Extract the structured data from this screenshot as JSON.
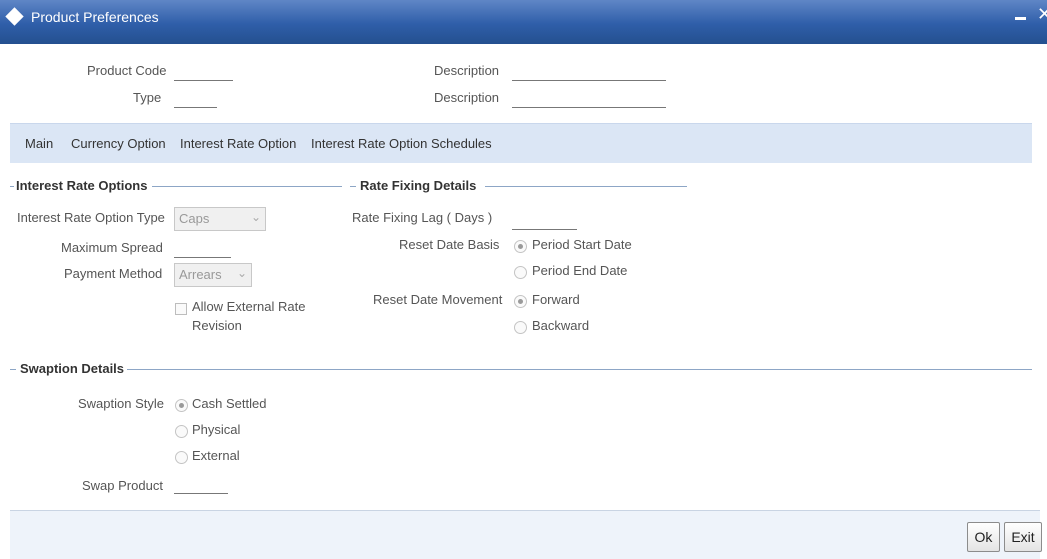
{
  "window": {
    "title": "Product Preferences",
    "minimize": "–",
    "close": "✕"
  },
  "header": {
    "product_code_label": "Product Code",
    "type_label": "Type",
    "description_label_1": "Description",
    "description_label_2": "Description"
  },
  "tabs": [
    {
      "label": "Main"
    },
    {
      "label": "Currency Option"
    },
    {
      "label": "Interest Rate Option"
    },
    {
      "label": "Interest Rate Option Schedules"
    }
  ],
  "interest_rate_options": {
    "section_title": "Interest Rate Options",
    "option_type_label": "Interest Rate Option Type",
    "option_type_value": "Caps",
    "max_spread_label": "Maximum Spread",
    "payment_method_label": "Payment Method",
    "payment_method_value": "Arrears",
    "allow_external_line1": "Allow External Rate",
    "allow_external_line2": "Revision"
  },
  "rate_fixing": {
    "section_title": "Rate Fixing Details",
    "lag_label": "Rate Fixing Lag ( Days )",
    "reset_basis_label": "Reset Date Basis",
    "reset_basis_options": [
      "Period Start Date",
      "Period End Date"
    ],
    "reset_basis_selected": "Period Start Date",
    "reset_movement_label": "Reset Date Movement",
    "reset_movement_options": [
      "Forward",
      "Backward"
    ],
    "reset_movement_selected": "Forward"
  },
  "swaption": {
    "section_title": "Swaption Details",
    "style_label": "Swaption Style",
    "style_options": [
      "Cash Settled",
      "Physical",
      "External"
    ],
    "style_selected": "Cash Settled",
    "swap_product_label": "Swap Product"
  },
  "footer": {
    "ok_label": "Ok",
    "exit_label": "Exit"
  }
}
